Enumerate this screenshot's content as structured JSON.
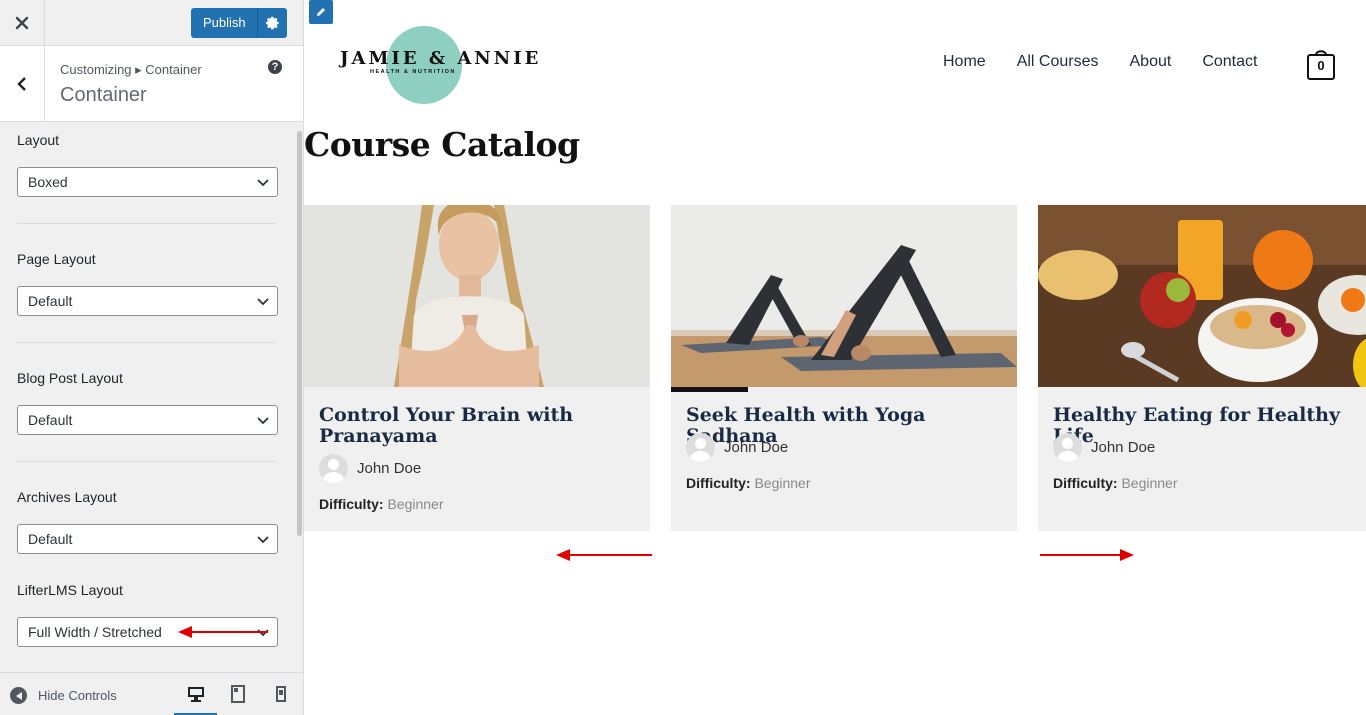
{
  "sidebar": {
    "close_icon": "close-icon",
    "publish_label": "Publish",
    "breadcrumb": "Customizing ▸ Container",
    "section_title": "Container",
    "help_symbol": "?",
    "controls": [
      {
        "label": "Layout",
        "value": "Boxed"
      },
      {
        "label": "Page Layout",
        "value": "Default"
      },
      {
        "label": "Blog Post Layout",
        "value": "Default"
      },
      {
        "label": "Archives Layout",
        "value": "Default"
      },
      {
        "label": "LifterLMS Layout",
        "value": "Full Width / Stretched"
      }
    ],
    "footer": {
      "hide_controls_label": "Hide Controls",
      "devices": [
        "desktop-icon",
        "tablet-icon",
        "mobile-icon"
      ]
    }
  },
  "site": {
    "logo_name": "JAMIE & ANNIE",
    "logo_tagline": "HEALTH & NUTRITION",
    "nav": [
      "Home",
      "All Courses",
      "About",
      "Contact"
    ],
    "cart_count": "0",
    "page_title": "Course Catalog",
    "courses": [
      {
        "title": "Control Your Brain with Pranayama",
        "author": "John Doe",
        "difficulty_label": "Difficulty:",
        "difficulty": "Beginner"
      },
      {
        "title": "Seek Health with Yoga Sadhana",
        "author": "John Doe",
        "difficulty_label": "Difficulty:",
        "difficulty": "Beginner"
      },
      {
        "title": "Healthy Eating for Healthy Life",
        "author": "John Doe",
        "difficulty_label": "Difficulty:",
        "difficulty": "Beginner"
      }
    ]
  },
  "colors": {
    "accent": "#2271b1",
    "annotation_arrow": "#e00000",
    "logo_circle": "#8fcfc1",
    "title_navy": "#1b2a44"
  }
}
